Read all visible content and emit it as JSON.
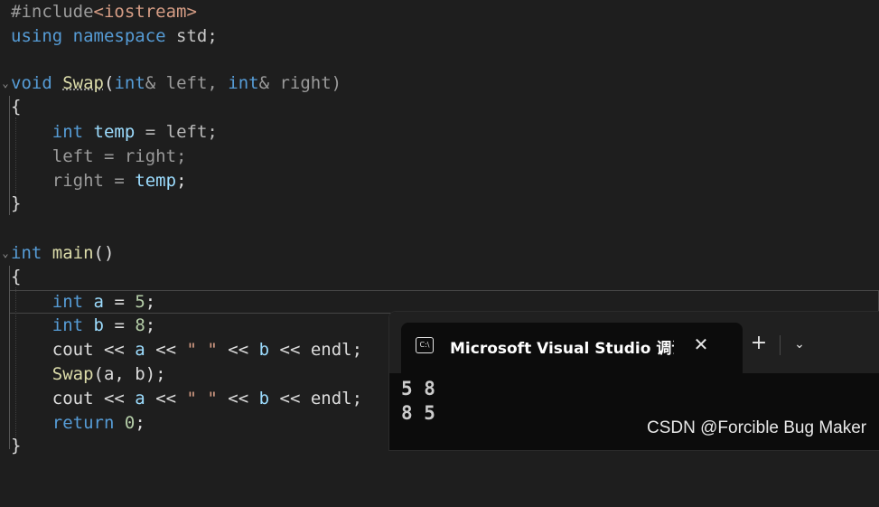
{
  "editor": {
    "line_include": {
      "directive": "#include",
      "header": "<iostream>"
    },
    "line_using": {
      "kw1": "using",
      "kw2": "namespace",
      "rest": " std;"
    },
    "swap_sig": {
      "ret": "void",
      "name": "Swap",
      "p1": "(",
      "t1": "int",
      "a1": "& left, ",
      "t2": "int",
      "a2": "& right)"
    },
    "open_brace": "{",
    "close_brace": "}",
    "swap_body": [
      {
        "t": "int",
        "v": "temp",
        "rest": " = left;"
      },
      {
        "lhs": "left",
        "rest": " = right;"
      },
      {
        "lhs": "right",
        "mid": " = ",
        "rhs": "temp",
        "end": ";"
      }
    ],
    "main_sig": {
      "ret": "int",
      "name": "main",
      "rest": "()"
    },
    "main_body": {
      "decl_a": {
        "t": "int",
        "v": "a",
        "op": " = ",
        "n": "5",
        "end": ";"
      },
      "decl_b": {
        "t": "int",
        "v": "b",
        "op": " = ",
        "n": "8",
        "end": ";"
      },
      "cout1": {
        "c": "cout",
        "op1": " << ",
        "a": "a",
        "op2": " << ",
        "s": "\" \"",
        "op3": " << ",
        "b": "b",
        "op4": " << ",
        "e": "endl",
        "end": ";"
      },
      "call": {
        "f": "Swap",
        "args": "(a, b);"
      },
      "cout2": {
        "c": "cout",
        "op1": " << ",
        "a": "a",
        "op2": " << ",
        "s": "\" \"",
        "op3": " << ",
        "b": "b",
        "op4": " << ",
        "e": "endl",
        "end": ";"
      },
      "ret": {
        "kw": "return",
        "sp": " ",
        "n": "0",
        "end": ";"
      }
    }
  },
  "console": {
    "tab_icon": "C:\\",
    "tab_title": "Microsoft Visual Studio 调试控制台",
    "close_icon": "✕",
    "new_tab_icon": "+",
    "dropdown_icon": "⌄",
    "output": [
      "5 8",
      "8 5"
    ]
  },
  "watermark": "CSDN @Forcible Bug Maker",
  "colors": {
    "background": "#1e1e1e",
    "keyword": "#569cd6",
    "function": "#dcdcaa",
    "variable": "#9cdcfe",
    "number": "#b5cea8",
    "string": "#d69d85"
  }
}
